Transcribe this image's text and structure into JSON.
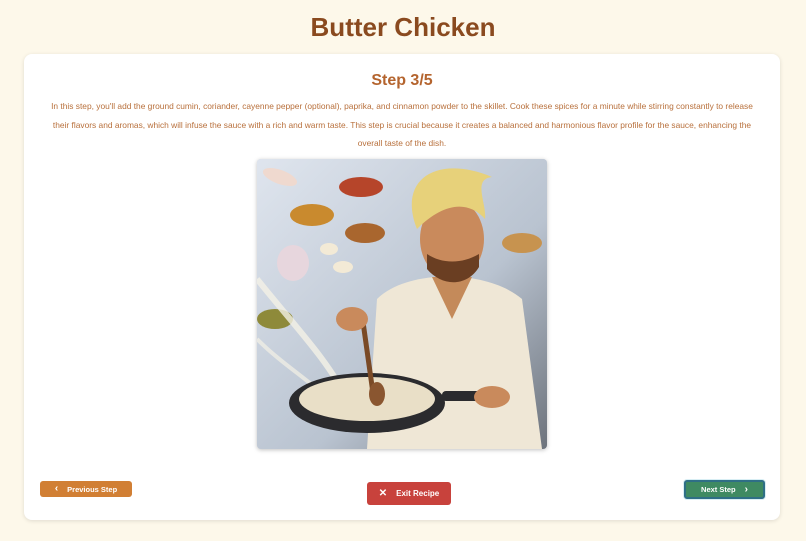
{
  "recipe": {
    "title": "Butter Chicken"
  },
  "step": {
    "title": "Step 3/5",
    "text": "In this step, you'll add the ground cumin, coriander, cayenne pepper (optional), paprika, and cinnamon powder to the skillet. Cook these spices for a minute while stirring constantly to release their flavors and aromas, which will infuse the sauce with a rich and warm taste. This step is crucial because it creates a balanced and harmonious flavor profile for the sauce, enhancing the overall taste of the dish."
  },
  "buttons": {
    "previous": {
      "label": "Previous Step",
      "icon": "chevron-left-icon"
    },
    "exit": {
      "label": "Exit Recipe",
      "icon": "close-icon"
    },
    "next": {
      "label": "Next Step",
      "icon": "chevron-right-icon"
    }
  },
  "colors": {
    "background": "#fdf8ea",
    "title": "#8a4a1f",
    "accent": "#b4642e",
    "previous": "#d17f34",
    "exit": "#c8423c",
    "next": "#3f8a62"
  }
}
